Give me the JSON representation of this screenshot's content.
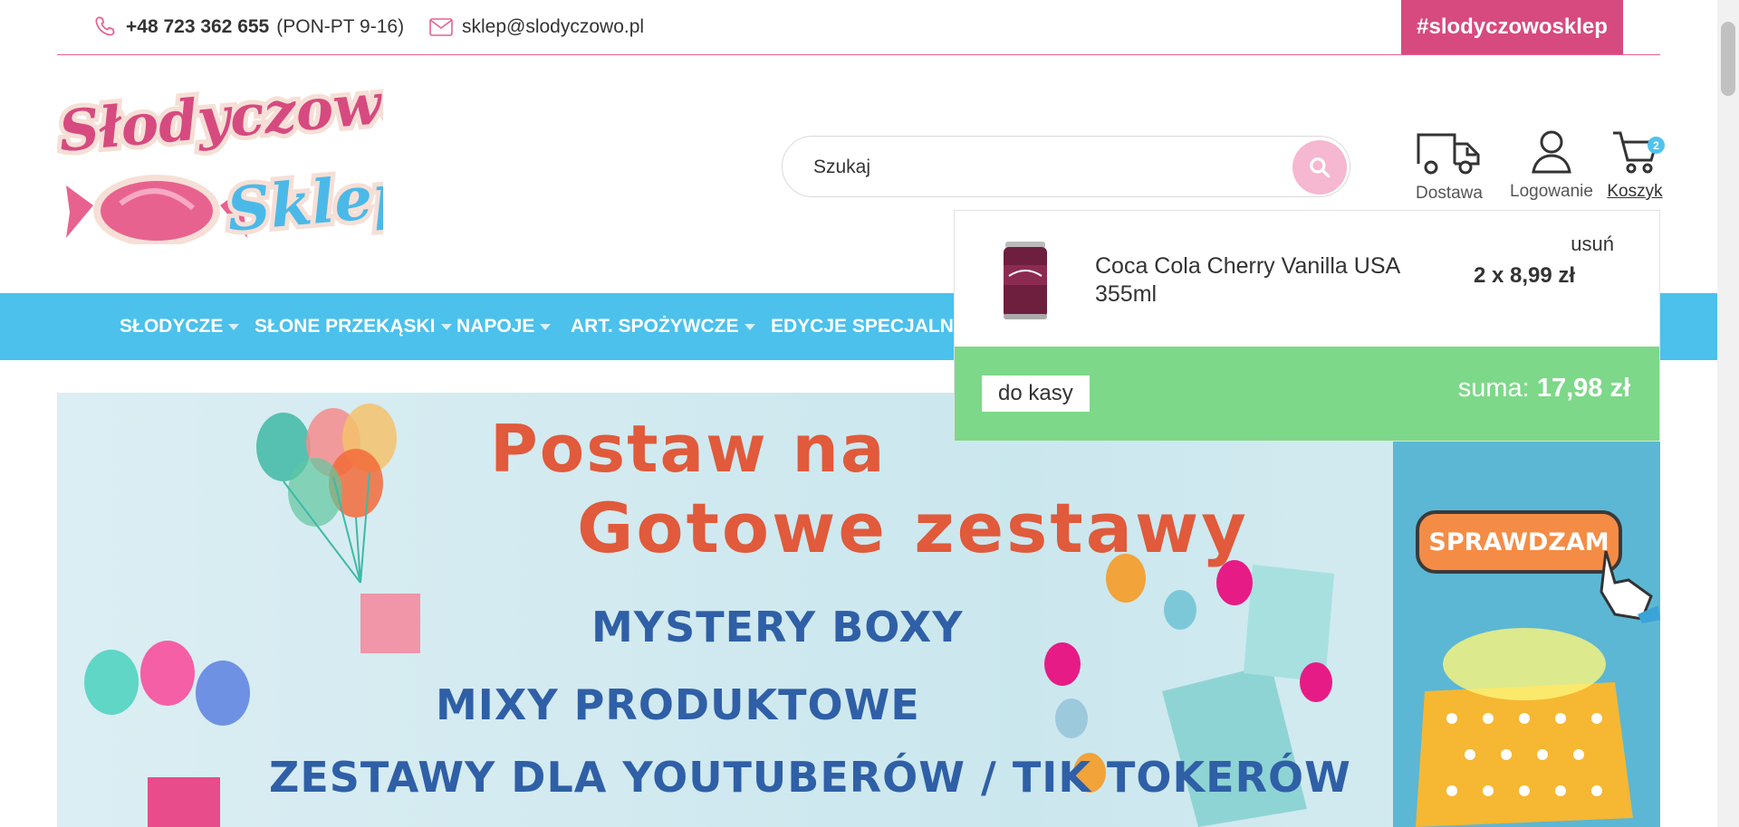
{
  "topbar": {
    "phone": "+48 723 362 655",
    "hours": "(PON-PT 9-16)",
    "email": "sklep@slodyczowo.pl",
    "hashtag": "#slodyczowosklep"
  },
  "logo": {
    "line1": "Słodyczowo",
    "line2": "Sklep"
  },
  "search": {
    "placeholder": "Szukaj"
  },
  "header_icons": {
    "delivery": "Dostawa",
    "login": "Logowanie",
    "cart": "Koszyk",
    "cart_count": "2"
  },
  "nav": {
    "items": [
      {
        "label": "SŁODYCZE"
      },
      {
        "label": "SŁONE PRZEKĄSKI"
      },
      {
        "label": "NAPOJE"
      },
      {
        "label": "ART. SPOŻYWCZE"
      },
      {
        "label": "EDYCJE SPECJALNE"
      }
    ]
  },
  "banner": {
    "title1": "Postaw na",
    "title2": "Gotowe zestawy",
    "line1": "MYSTERY BOXY",
    "line2": "MIXY PRODUKTOWE",
    "line3": "ZESTAWY DLA YOUTUBERÓW / TIK TOKERÓW",
    "cta": "SPRAWDZAM"
  },
  "cart_dropdown": {
    "remove": "usuń",
    "item_name": "Coca Cola Cherry Vanilla USA 355ml",
    "item_qty_price": "2 x 8,99 zł",
    "checkout": "do kasy",
    "sum_label": "suma:",
    "sum_value": "17,98 zł"
  },
  "colors": {
    "pink": "#d64a7f",
    "nav_blue": "#4bc1ec",
    "green": "#7dd889",
    "banner_red": "#e05a3b",
    "banner_blue": "#2f5fa6"
  }
}
